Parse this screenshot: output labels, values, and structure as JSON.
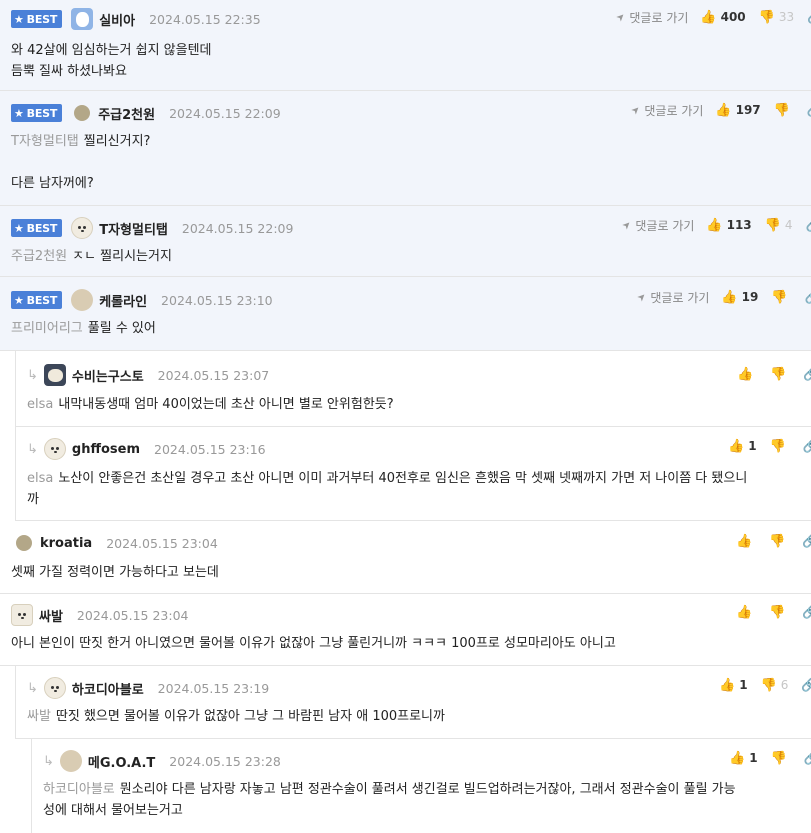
{
  "ui": {
    "best_label": "BEST",
    "go_reply_label": "댓글로 가기",
    "reply_arrow": "↳",
    "star_icon": "★",
    "nav_icon": "➤",
    "like_icon": "👍",
    "dislike_icon": "👎",
    "share_icon": "🔗",
    "accent_color": "#4a80d8"
  },
  "comments": [
    {
      "nick": "실비아",
      "date": "2024.05.15 22:35",
      "likes": "400",
      "dislikes": "33",
      "lines": [
        "와 42살에 임심하는거 쉽지 않을텐데",
        "듬뿍 질싸 하셨나봐요"
      ]
    },
    {
      "nick": "주급2천원",
      "date": "2024.05.15 22:09",
      "likes": "197",
      "mention": "T자형멀티탭",
      "line1": "찔리신거지?",
      "line2": "다른 남자꺼에?"
    },
    {
      "nick": "T자형멀티탭",
      "date": "2024.05.15 22:09",
      "likes": "113",
      "dislikes": "4",
      "mention": "주급2천원",
      "text": "ㅈㄴ 찔리시는거지"
    },
    {
      "nick": "케롤라인",
      "date": "2024.05.15 23:10",
      "likes": "19",
      "mention": "프리미어리그",
      "text": "풀릴 수 있어"
    },
    {
      "nick": "수비는구스토",
      "date": "2024.05.15 23:07",
      "mention": "elsa",
      "text": "내막내동생때 엄마 40이었는데 초산 아니면 별로 안위험한듯?"
    },
    {
      "nick": "ghffosem",
      "date": "2024.05.15 23:16",
      "likes": "1",
      "mention": "elsa",
      "line1": "노산이 안좋은건 초산일 경우고 초산 아니면 이미 과거부터 40전후로 임신은 흔했음 막 셋째 넷째까지 가면 저 나이쯤 다 됐으니",
      "line2": "까"
    },
    {
      "nick": "kroatia",
      "date": "2024.05.15 23:04",
      "text": "셋째 가질 정력이면 가능하다고 보는데"
    },
    {
      "nick": "싸발",
      "date": "2024.05.15 23:04",
      "text": "아니 본인이 딴짓 한거 아니였으면 물어볼 이유가 없잖아 그냥 풀린거니까 ㅋㅋㅋ 100프로 성모마리아도 아니고"
    },
    {
      "nick": "하코디아블로",
      "date": "2024.05.15 23:19",
      "likes": "1",
      "dislikes": "6",
      "mention": "싸발",
      "text": "딴짓 했으면 물어볼 이유가 없잖아 그냥 그 바람핀 남자 애 100프로니까"
    },
    {
      "nick": "메G.O.A.T",
      "date": "2024.05.15 23:28",
      "likes": "1",
      "mention": "하코디아블로",
      "line1": "뭔소리야 다른 남자랑 자놓고 남편 정관수술이 풀려서 생긴걸로 빌드업하려는거잖아, 그래서 정관수술이 풀릴 가능",
      "line2": "성에 대해서 물어보는거고"
    }
  ]
}
